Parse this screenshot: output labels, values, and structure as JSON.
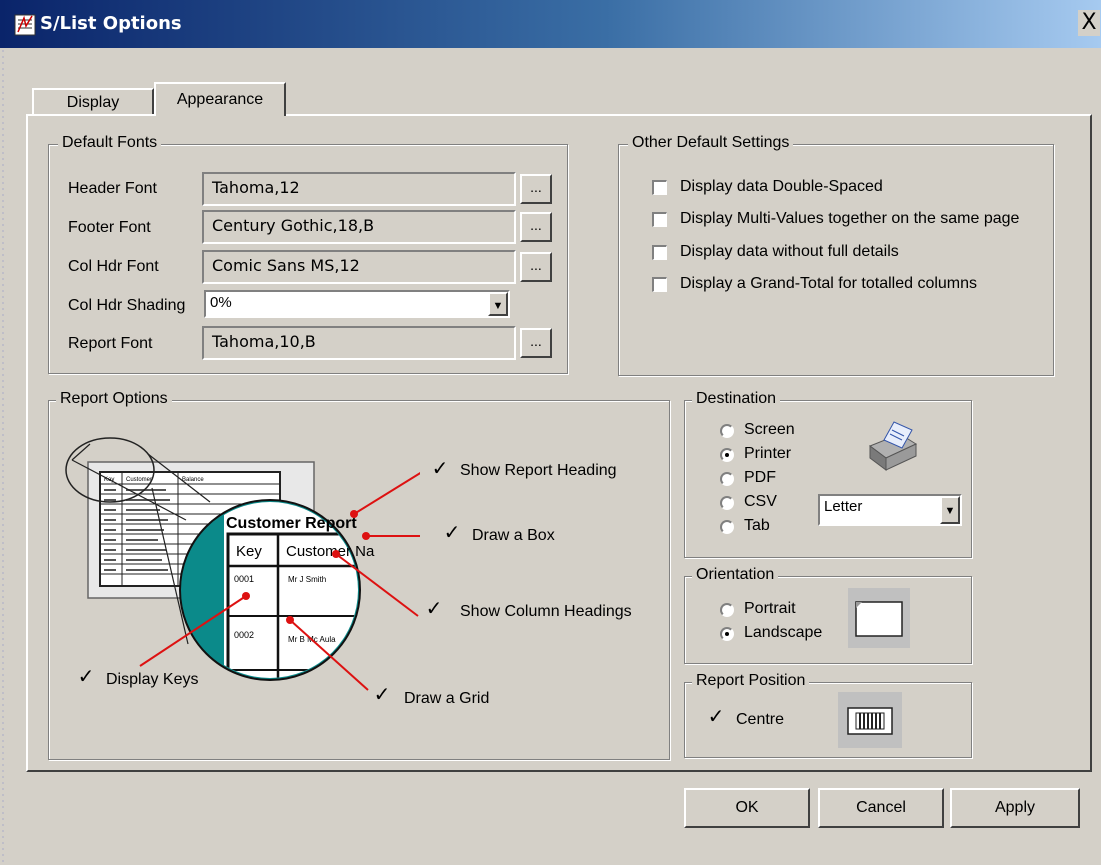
{
  "window": {
    "title": "S/List Options",
    "close_label": "X"
  },
  "tabs": [
    {
      "label": "Display",
      "active": false
    },
    {
      "label": "Appearance",
      "active": true
    }
  ],
  "default_fonts": {
    "legend": "Default Fonts",
    "header_font": {
      "label": "Header Font",
      "value": "Tahoma,12"
    },
    "footer_font": {
      "label": "Footer Font",
      "value": "Century Gothic,18,B"
    },
    "col_hdr_font": {
      "label": "Col Hdr Font",
      "value": "Comic Sans MS,12"
    },
    "col_hdr_shading": {
      "label": "Col Hdr Shading",
      "value": "0%"
    },
    "report_font": {
      "label": "Report Font",
      "value": "Tahoma,10,B"
    },
    "browse_label": "..."
  },
  "other_settings": {
    "legend": "Other Default Settings",
    "items": [
      {
        "label": "Display data Double-Spaced",
        "checked": false
      },
      {
        "label": "Display Multi-Values together on the same page",
        "checked": false
      },
      {
        "label": "Display data without full details",
        "checked": false
      },
      {
        "label": "Display a Grand-Total for totalled columns",
        "checked": false
      }
    ]
  },
  "report_options": {
    "legend": "Report Options",
    "show_report_heading": {
      "label": "Show Report Heading",
      "checked": true
    },
    "draw_a_box": {
      "label": "Draw a Box",
      "checked": true
    },
    "show_column_headings": {
      "label": "Show Column Headings",
      "checked": true
    },
    "display_keys": {
      "label": "Display Keys",
      "checked": true
    },
    "draw_a_grid": {
      "label": "Draw a Grid",
      "checked": true
    },
    "check_mark": "✓",
    "illustration": {
      "title": "Customer Report",
      "col_key": "Key",
      "col_name": "Customer Na",
      "row1_key": "0001",
      "row1_name": "Mr J Smith",
      "row2_key": "0002",
      "row2_name": "Mr B Mc Aula",
      "mini_header_1": "Key",
      "mini_header_2": "Customer",
      "mini_header_3": "Balance"
    }
  },
  "destination": {
    "legend": "Destination",
    "options": [
      {
        "label": "Screen",
        "selected": false
      },
      {
        "label": "Printer",
        "selected": true
      },
      {
        "label": "PDF",
        "selected": false
      },
      {
        "label": "CSV",
        "selected": false
      },
      {
        "label": "Tab",
        "selected": false
      }
    ],
    "paper_size": "Letter"
  },
  "orientation": {
    "legend": "Orientation",
    "options": [
      {
        "label": "Portrait",
        "selected": false
      },
      {
        "label": "Landscape",
        "selected": true
      }
    ]
  },
  "report_position": {
    "legend": "Report Position",
    "centre": {
      "label": "Centre",
      "checked": true
    }
  },
  "buttons": {
    "ok": "OK",
    "cancel": "Cancel",
    "apply": "Apply"
  },
  "colors": {
    "titlebar_start": "#0a246a",
    "titlebar_end": "#a6caf0",
    "dialog_bg": "#d4d0c8",
    "illustration_teal": "#008080",
    "pointer_red": "#dd1111"
  }
}
